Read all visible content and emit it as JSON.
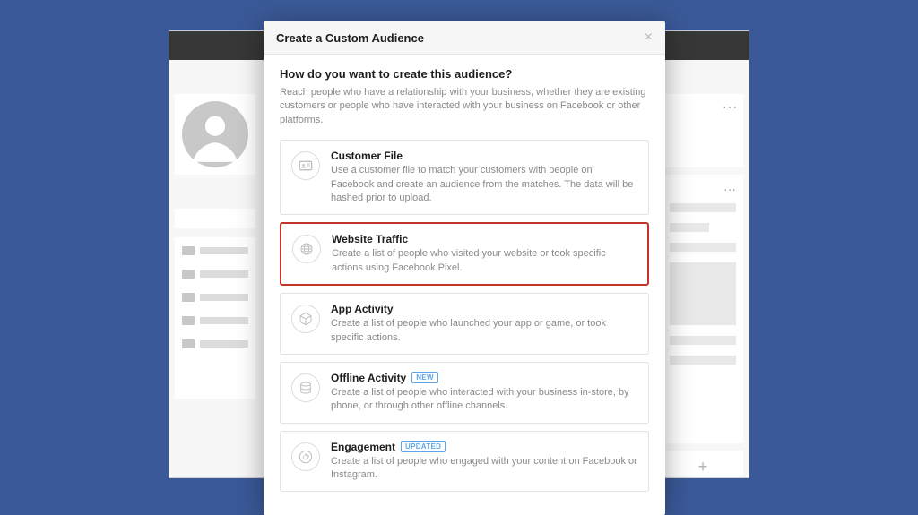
{
  "modal": {
    "title": "Create a Custom Audience",
    "question": "How do you want to create this audience?",
    "subtext": "Reach people who have a relationship with your business, whether they are existing customers or people who have interacted with your business on Facebook or other platforms.",
    "options": [
      {
        "id": "customer-file",
        "icon": "id-card-icon",
        "title": "Customer File",
        "desc": "Use a customer file to match your customers with people on Facebook and create an audience from the matches. The data will be hashed prior to upload.",
        "badge": null,
        "highlight": false
      },
      {
        "id": "website-traffic",
        "icon": "globe-icon",
        "title": "Website Traffic",
        "desc": "Create a list of people who visited your website or took specific actions using Facebook Pixel.",
        "badge": null,
        "highlight": true
      },
      {
        "id": "app-activity",
        "icon": "box-icon",
        "title": "App Activity",
        "desc": "Create a list of people who launched your app or game, or took specific actions.",
        "badge": null,
        "highlight": false
      },
      {
        "id": "offline-activity",
        "icon": "stack-icon",
        "title": "Offline Activity",
        "desc": "Create a list of people who interacted with your business in-store, by phone, or through other offline channels.",
        "badge": "NEW",
        "highlight": false
      },
      {
        "id": "engagement",
        "icon": "thumb-icon",
        "title": "Engagement",
        "desc": "Create a list of people who engaged with your content on Facebook or Instagram.",
        "badge": "UPDATED",
        "highlight": false
      }
    ]
  },
  "background": {
    "more_dots": "···",
    "plus": "+"
  }
}
